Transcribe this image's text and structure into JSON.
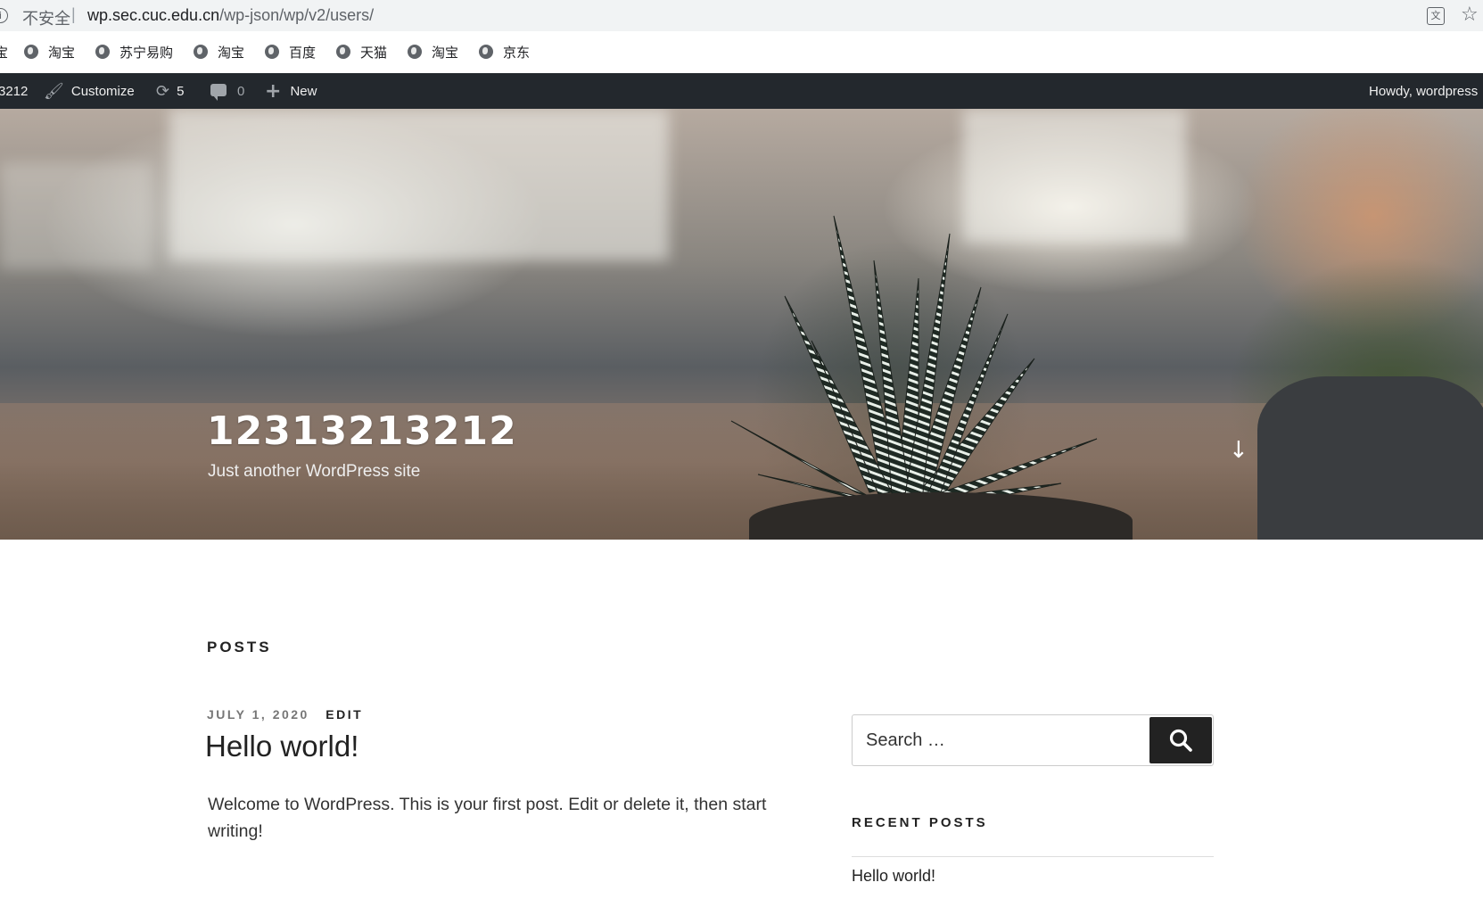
{
  "browser": {
    "insecure_label": "不安全",
    "separator": "|",
    "url_host": "wp.sec.cuc.edu.cn",
    "url_path": "/wp-json/wp/v2/users/",
    "bookmarks": [
      "淘宝",
      "苏宁易购",
      "淘宝",
      "百度",
      "天猫",
      "淘宝",
      "京东"
    ],
    "bookmark_cut": "宝"
  },
  "adminbar": {
    "site_name_partial": "3212",
    "customize_label": "Customize",
    "updates_count": "5",
    "comments_count": "0",
    "new_label": "New",
    "howdy": "Howdy, wordpress"
  },
  "header": {
    "site_title": "12313213212",
    "site_description": "Just another WordPress site"
  },
  "main": {
    "section_heading": "POSTS",
    "post": {
      "date": "JULY 1, 2020",
      "edit_label": "EDIT",
      "title": "Hello world!",
      "excerpt": "Welcome to WordPress. This is your first post. Edit or delete it, then start writing!"
    }
  },
  "sidebar": {
    "search_placeholder": "Search …",
    "recent_heading": "RECENT POSTS",
    "recent_posts": [
      "Hello world!"
    ]
  }
}
